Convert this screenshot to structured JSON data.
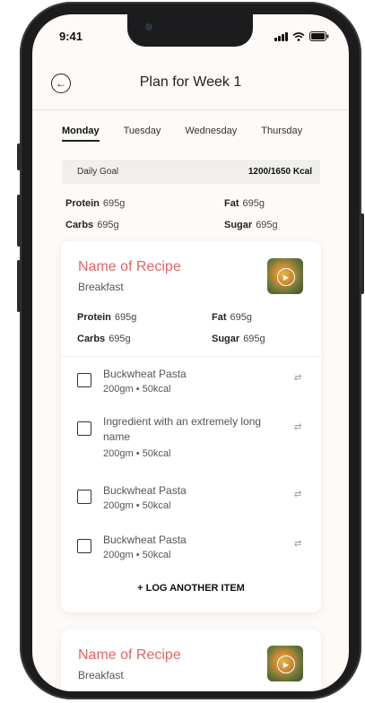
{
  "status": {
    "time": "9:41"
  },
  "header": {
    "back_icon": "arrow-left-circle-icon",
    "title": "Plan for Week 1"
  },
  "days": [
    "Monday",
    "Tuesday",
    "Wednesday",
    "Thursday"
  ],
  "active_day": "Monday",
  "daily_goal": {
    "label": "Daily Goal",
    "value": "1200/1650 Kcal"
  },
  "daily_macros": {
    "protein": {
      "label": "Protein",
      "value": "695g"
    },
    "fat": {
      "label": "Fat",
      "value": "695g"
    },
    "carbs": {
      "label": "Carbs",
      "value": "695g"
    },
    "sugar": {
      "label": "Sugar",
      "value": "695g"
    }
  },
  "recipes": [
    {
      "name": "Name of Recipe",
      "meal": "Breakfast",
      "macros": {
        "protein": {
          "label": "Protein",
          "value": "695g"
        },
        "fat": {
          "label": "Fat",
          "value": "695g"
        },
        "carbs": {
          "label": "Carbs",
          "value": "695g"
        },
        "sugar": {
          "label": "Sugar",
          "value": "695g"
        }
      },
      "items": [
        {
          "name": "Buckwheat Pasta",
          "detail": "200gm • 50kcal"
        },
        {
          "name": "Ingredient with an extremely long name",
          "detail": "200gm • 50kcal"
        },
        {
          "name": "Buckwheat Pasta",
          "detail": "200gm • 50kcal"
        },
        {
          "name": "Buckwheat Pasta",
          "detail": "200gm • 50kcal"
        }
      ],
      "log_button": "+ LOG ANOTHER ITEM"
    },
    {
      "name": "Name of Recipe",
      "meal": "Breakfast"
    }
  ],
  "colors": {
    "accent": "#e36464",
    "background": "#fdfaf7",
    "goal_bg": "#f1efec"
  }
}
